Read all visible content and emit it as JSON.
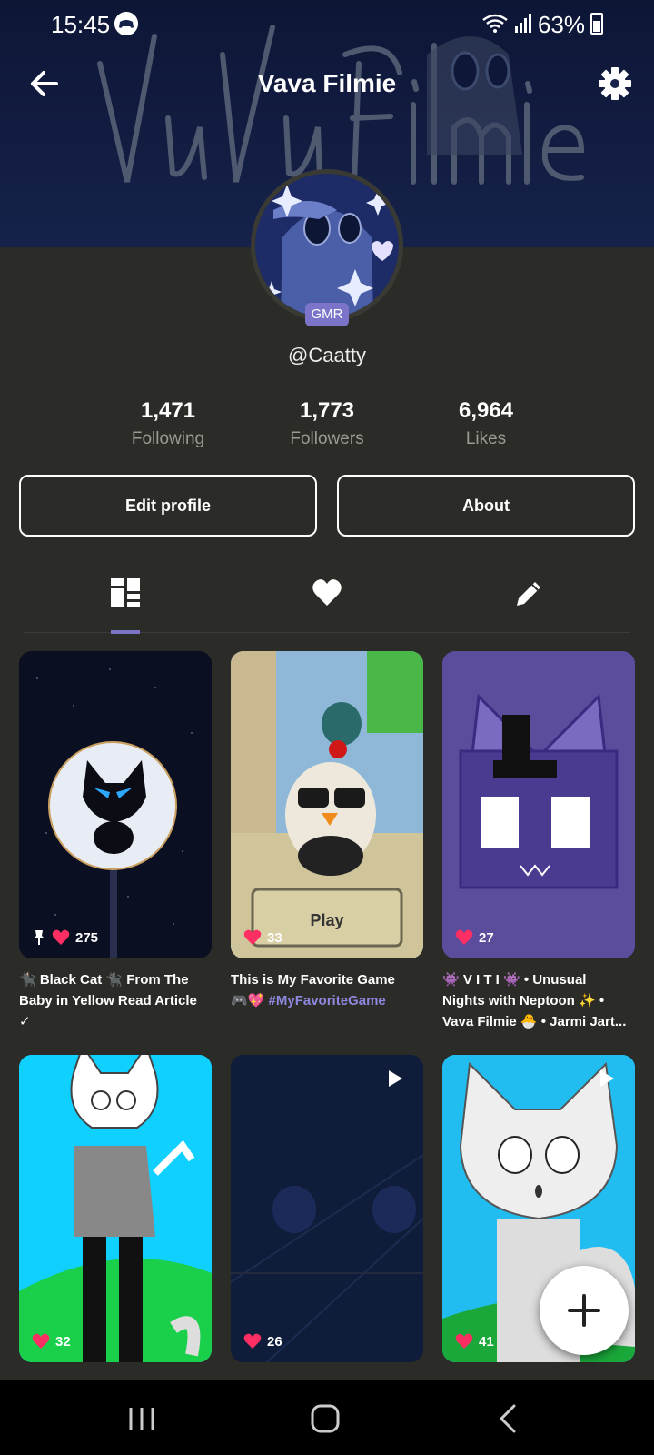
{
  "status": {
    "time": "15:45",
    "battery": "63%"
  },
  "header": {
    "title": "Vava Filmie",
    "back_icon": "arrow-left-icon",
    "settings_icon": "gear-icon"
  },
  "profile": {
    "badge": "GMR",
    "username": "@Caatty"
  },
  "stats": [
    {
      "value": "1,471",
      "label": "Following"
    },
    {
      "value": "1,773",
      "label": "Followers"
    },
    {
      "value": "6,964",
      "label": "Likes"
    }
  ],
  "buttons": {
    "edit": "Edit profile",
    "about": "About"
  },
  "tabs": [
    {
      "icon": "grid-layout-icon",
      "active": true
    },
    {
      "icon": "heart-icon",
      "active": false
    },
    {
      "icon": "pencil-icon",
      "active": false
    }
  ],
  "posts": [
    {
      "likes": "275",
      "pinned": true,
      "caption_line1": "🐈‍⬛ Black Cat 🐈‍⬛ From The",
      "caption_line2": "Baby in Yellow Read Article",
      "caption_line3": "✓"
    },
    {
      "likes": "33",
      "caption_line1": "This is My Favorite Game",
      "caption_line2": "🎮💖",
      "caption_tag": "#MyFavoriteGame",
      "play_text": "Play"
    },
    {
      "likes": "27",
      "caption_line1": "👾 V I T I 👾 • Unusual",
      "caption_line2": "Nights with Neptoon ✨ •",
      "caption_line3": "Vava Filmie 🐣 • Jarmi Jart..."
    },
    {
      "likes": "32"
    },
    {
      "likes": "26",
      "video": true
    },
    {
      "likes": "41",
      "video": true
    }
  ],
  "colors": {
    "accent": "#7b74c9",
    "heart": "#ff2e63",
    "background": "#2b2b28"
  }
}
